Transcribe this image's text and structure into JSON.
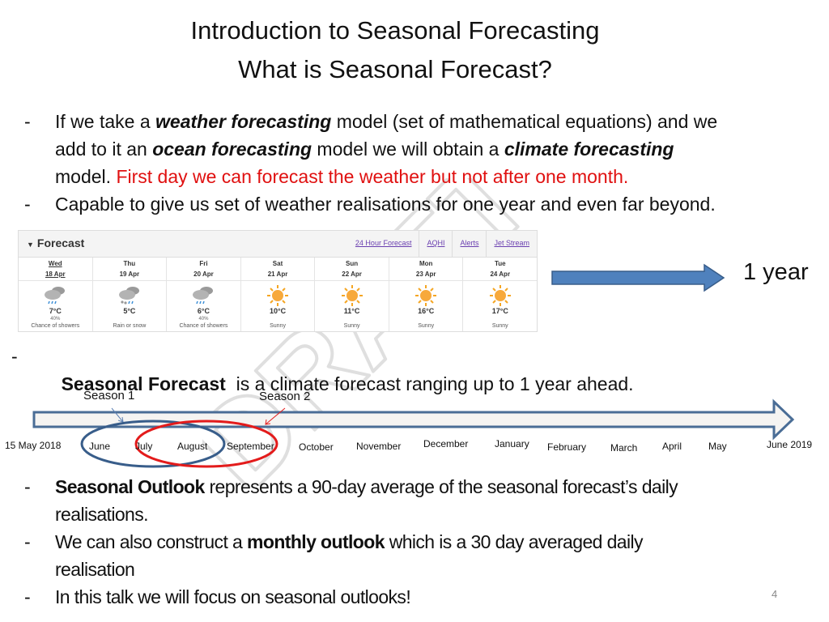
{
  "slide": {
    "title_line1": "Introduction to Seasonal Forecasting",
    "title_line2": "What is Seasonal Forecast?",
    "page_number": "4",
    "watermark": "DRAFT"
  },
  "intro_bullets": {
    "dash": "-",
    "b1_part1": "If we take a ",
    "b1_bold1": "weather forecasting",
    "b1_part2": " model (set of mathematical equations) and we",
    "b1_part3": "add to it an ",
    "b1_bold2": "ocean forecasting",
    "b1_part4": " model we will obtain a ",
    "b1_bold3": "climate forecasting",
    "b1_part5": "model. ",
    "b1_red": "First day we can forecast the weather but not after one month.",
    "b2": "Capable to give us set of weather realisations for one year and even far beyond."
  },
  "forecast_widget": {
    "title": "Forecast",
    "tabs": [
      "24 Hour Forecast",
      "AQHI",
      "Alerts",
      "Jet Stream"
    ],
    "days": [
      {
        "day": "Wed",
        "date": "18 Apr",
        "icon": "rain-cloud",
        "temp": "7°C",
        "pop": "40%",
        "condition": "Chance of showers",
        "current": true
      },
      {
        "day": "Thu",
        "date": "19 Apr",
        "icon": "rain-snow-cloud",
        "temp": "5°C",
        "pop": "",
        "condition": "Rain or snow",
        "current": false
      },
      {
        "day": "Fri",
        "date": "20 Apr",
        "icon": "rain-cloud",
        "temp": "6°C",
        "pop": "40%",
        "condition": "Chance of showers",
        "current": false
      },
      {
        "day": "Sat",
        "date": "21 Apr",
        "icon": "sun",
        "temp": "10°C",
        "pop": "",
        "condition": "Sunny",
        "current": false
      },
      {
        "day": "Sun",
        "date": "22 Apr",
        "icon": "sun",
        "temp": "11°C",
        "pop": "",
        "condition": "Sunny",
        "current": false
      },
      {
        "day": "Mon",
        "date": "23 Apr",
        "icon": "sun",
        "temp": "16°C",
        "pop": "",
        "condition": "Sunny",
        "current": false
      },
      {
        "day": "Tue",
        "date": "24 Apr",
        "icon": "sun",
        "temp": "17°C",
        "pop": "",
        "condition": "Sunny",
        "current": false
      }
    ]
  },
  "year_arrow": {
    "label": "1 year",
    "color": "#4f81bd"
  },
  "seasonal_forecast": {
    "dash": "-",
    "bold": "Seasonal Forecast",
    "text": "  is a climate forecast ranging up to 1 year ahead."
  },
  "timeline": {
    "season1": "Season 1",
    "season2": "Season 2",
    "season1_color": "#385d8a",
    "season2_color": "#e31b1b",
    "months": [
      "15 May 2018",
      "June",
      "July",
      "August",
      "September",
      "October",
      "November",
      "December",
      "January",
      "February",
      "March",
      "April",
      "May",
      "June 2019"
    ]
  },
  "outlook_bullets": {
    "dash": "-",
    "b1_bold": "Seasonal Outlook",
    "b1_text": " represents a 90-day average of the seasonal forecast’s daily",
    "b1_cont": "realisations.",
    "b2_text1": "We can also construct a ",
    "b2_bold": "monthly outlook",
    "b2_text2": " which is a 30 day averaged daily",
    "b2_cont": "realisation",
    "b3_text": "In this talk we will focus on seasonal outlooks!"
  }
}
